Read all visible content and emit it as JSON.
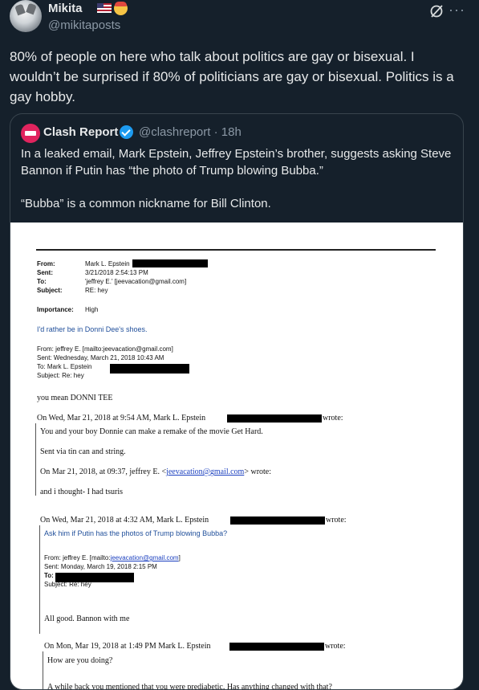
{
  "tweet": {
    "author_name": "Mikita",
    "author_handle": "@mikitaposts",
    "flag_icon": "us-flag-icon",
    "emoji_icon": "cowboy-face-icon",
    "text": "80% of people on here who talk about politics are gay or bisexual. I wouldn’t be surprised if 80% of politicians are gay or bisexual. Politics is a gay hobby."
  },
  "quoted": {
    "author_name": "Clash Report",
    "author_handle": "@clashreport · 18h",
    "text_1": "In a leaked email, Mark Epstein, Jeffrey Epstein’s brother, suggests asking Steve Bannon if Putin has “the photo of Trump blowing Bubba.”",
    "text_2": "“Bubba” is a common nickname for Bill Clinton."
  },
  "email": {
    "from_label": "From:",
    "from_value": "Mark L. Epstein",
    "sent_label": "Sent:",
    "sent_value": "3/21/2018 2:54:13 PM",
    "to_label": "To:",
    "to_value": "'jeffrey E.' [jeevacation@gmail.com]",
    "subject_label": "Subject:",
    "subject_value": "RE: hey",
    "importance_label": "Importance:",
    "importance_value": "High",
    "reply_blue": "I'd rather be in Donni Dee's shoes.",
    "h2_from": "From: jeffrey E. [mailto:jeevacation@gmail.com]",
    "h2_sent": "Sent: Wednesday, March 21, 2018 10:43 AM",
    "h2_to": "To: Mark L. Epstein",
    "h2_subject": "Subject: Re: hey",
    "donni": "you mean DONNI TEE",
    "wrote1_prefix": "On Wed, Mar 21, 2018 at 9:54 AM, Mark L. Epstein",
    "wrote_suffix": "wrote:",
    "line_gethard": "You and your boy Donnie can make a remake of the movie Get Hard.",
    "line_tin": "Sent via tin can and string.",
    "wrote2_prefix": "On Mar 21, 2018, at 09:37, jeffrey E. <",
    "wrote2_email": "jeevacation@gmail.com",
    "wrote2_suffix": "> wrote:",
    "line_tsuris": "and i thought- I had tsuris",
    "wrote3_prefix": "On Wed, Mar 21, 2018 at 4:32 AM, Mark L. Epstein",
    "line_putin": "Ask him if Putin has the photos of Trump blowing Bubba?",
    "h3_from_prefix": "From: jeffrey E. [mailto:",
    "h3_from_email": "jeevacation@gmail.com",
    "h3_from_suffix": "]",
    "h3_sent": "Sent: Monday, March 19, 2018 2:15 PM",
    "h3_to": "To:",
    "h3_subject": "Subject: Re: hey",
    "line_bannon": "All good. Bannon with me",
    "wrote4_prefix": "On Mon, Mar 19, 2018 at 1:49 PM Mark L. Epstein",
    "line_howare": "How are you doing?",
    "line_cut": "A while back you mentioned that you were prediabetic. Has anything changed with that?"
  }
}
